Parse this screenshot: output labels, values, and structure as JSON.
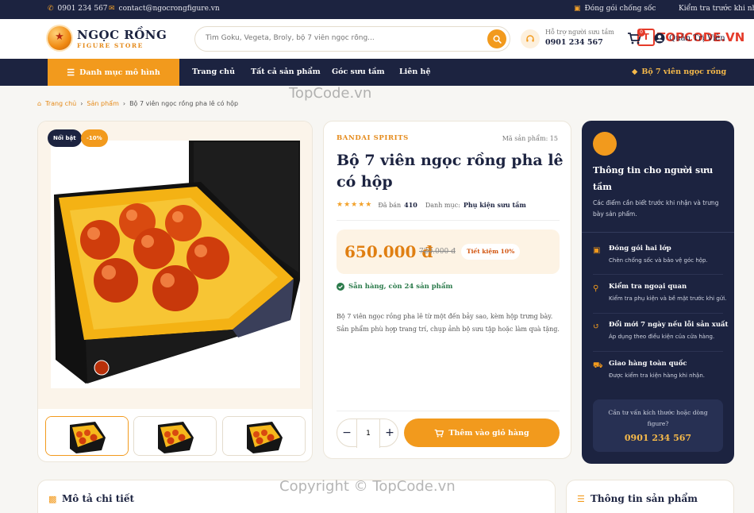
{
  "topbar": {
    "phone": "0901 234 567",
    "email": "contact@ngocrongfigure.vn",
    "packaging": "Đóng gói chống sốc",
    "inspect": "Kiểm tra trước khi nhận"
  },
  "header": {
    "logo_name": "NGỌC RỒNG",
    "logo_sub": "FIGURE STORE",
    "search_placeholder": "Tìm Goku, Vegeta, Broly, bộ 7 viên ngọc rồng...",
    "support_label": "Hỗ trợ người sưu tầm",
    "support_phone": "0901 234 567",
    "cart_count": "0",
    "account": "Quản Trị Viên"
  },
  "nav": {
    "category": "Danh mục mô hình",
    "links": [
      "Trang chủ",
      "Tất cả sản phẩm",
      "Góc sưu tầm",
      "Liên hệ"
    ],
    "promo": "Bộ 7 viên ngọc rồng"
  },
  "breadcrumb": [
    "Trang chủ",
    "Sản phẩm",
    "Bộ 7 viên ngọc rồng pha lê có hộp"
  ],
  "gallery": {
    "badge_featured": "Nổi bật",
    "badge_discount": "-10%"
  },
  "product": {
    "brand": "BANDAI SPIRITS",
    "sku": "Mã sản phẩm: 15",
    "title": "Bộ 7 viên ngọc rồng pha lê có hộp",
    "rating": 5,
    "sold_label": "Đã bán",
    "sold": "410",
    "category_label": "Danh mục:",
    "category": "Phụ kiện sưu tầm",
    "price": "650.000 đ",
    "old_price": "720.000 đ",
    "saving": "Tiết kiệm 10%",
    "stock": "Sẵn hàng, còn 24 sản phẩm",
    "description": "Bộ 7 viên ngọc rồng pha lê từ một đến bảy sao, kèm hộp trưng bày. Sản phẩm phù hợp trang trí, chụp ảnh bộ sưu tập hoặc làm quà tặng.",
    "quantity": "1",
    "add_to_cart": "Thêm vào giỏ hàng"
  },
  "side": {
    "title": "Thông tin cho người sưu tầm",
    "subtitle": "Các điểm cần biết trước khi nhận và trưng bày sản phẩm.",
    "items": [
      {
        "icon": "box-icon",
        "title": "Đóng gói hai lớp",
        "desc": "Chèn chống sốc và bảo vệ góc hộp."
      },
      {
        "icon": "magnifier-icon",
        "title": "Kiểm tra ngoại quan",
        "desc": "Kiểm tra phụ kiện và bề mặt trước khi gửi."
      },
      {
        "icon": "return-icon",
        "title": "Đổi mới 7 ngày nếu lỗi sản xuất",
        "desc": "Áp dụng theo điều kiện của cửa hàng."
      },
      {
        "icon": "truck-icon",
        "title": "Giao hàng toàn quốc",
        "desc": "Được kiểm tra kiện hàng khi nhận."
      }
    ],
    "cta_text": "Cần tư vấn kích thước hoặc dòng figure?",
    "cta_phone": "0901 234 567"
  },
  "bottom": {
    "description_title": "Mô tả chi tiết",
    "info_title": "Thông tin sản phẩm"
  },
  "watermarks": {
    "logo": "TOPCODE.VN",
    "center": "TopCode.vn",
    "copyright": "Copyright © TopCode.vn"
  },
  "colors": {
    "navy": "#1c2340",
    "accent": "#f29a1d",
    "price": "#e07f12"
  }
}
